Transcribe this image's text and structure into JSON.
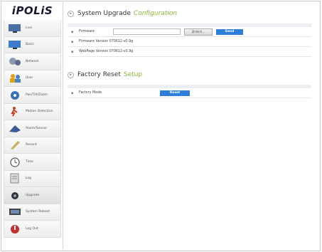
{
  "logo": "iPOLiS",
  "sidebar": {
    "items": [
      {
        "label": "Live",
        "icon": "monitor-icon"
      },
      {
        "label": "Basic",
        "icon": "monitor-icon"
      },
      {
        "label": "Network",
        "icon": "network-icon"
      },
      {
        "label": "User",
        "icon": "users-icon"
      },
      {
        "label": "Pan/Tilt/Zoom",
        "icon": "ptz-icon"
      },
      {
        "label": "Motion Detection",
        "icon": "motion-icon"
      },
      {
        "label": "Alarm/Sensor",
        "icon": "alarm-icon"
      },
      {
        "label": "Record",
        "icon": "record-icon"
      },
      {
        "label": "Time",
        "icon": "clock-icon"
      },
      {
        "label": "Log",
        "icon": "log-icon"
      },
      {
        "label": "Upgrade",
        "icon": "upgrade-icon"
      },
      {
        "label": "System Reboot",
        "icon": "reboot-icon"
      },
      {
        "label": "Log Out",
        "icon": "logout-icon"
      }
    ]
  },
  "upgrade": {
    "title": "System Upgrade",
    "title_accent": "Configuration",
    "firmware_label": "Firmware",
    "browse_label": "찾아보기...",
    "send_label": "Send",
    "firmware_version": "Firmware Version 070612-v0.9g",
    "webpage_version": "WebPage Version 070612-v0.9g"
  },
  "reset": {
    "title": "Factory Reset",
    "title_accent": "Setup",
    "mode_label": "Factory Mode",
    "reset_label": "Reset"
  }
}
